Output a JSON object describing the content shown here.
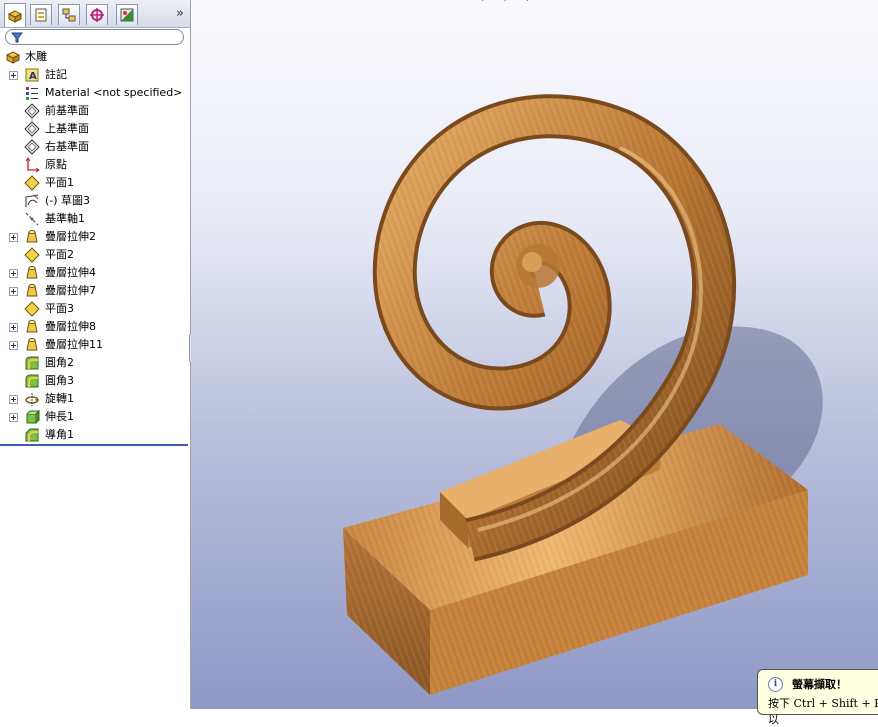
{
  "tabs": [
    {
      "name": "feature-manager-tab",
      "icon": "feature-tree-icon"
    },
    {
      "name": "property-manager-tab",
      "icon": "property-icon"
    },
    {
      "name": "configuration-manager-tab",
      "icon": "configuration-icon"
    },
    {
      "name": "dimxpert-tab",
      "icon": "crosshair-icon"
    },
    {
      "name": "display-manager-tab",
      "icon": "display-icon"
    }
  ],
  "tabbar": {
    "more": "»"
  },
  "tree": {
    "root": "木雕",
    "items": [
      {
        "label": "註記",
        "icon": "annotation-icon",
        "expandable": true
      },
      {
        "label": "Material <not specified>",
        "icon": "material-icon",
        "expandable": false
      },
      {
        "label": "前基準面",
        "icon": "plane-icon",
        "expandable": false
      },
      {
        "label": "上基準面",
        "icon": "plane-icon",
        "expandable": false
      },
      {
        "label": "右基準面",
        "icon": "plane-icon",
        "expandable": false
      },
      {
        "label": "原點",
        "icon": "origin-icon",
        "expandable": false
      },
      {
        "label": "平面1",
        "icon": "plane-feature-icon",
        "expandable": false
      },
      {
        "label": "(-) 草圖3",
        "icon": "sketch-icon",
        "expandable": false
      },
      {
        "label": "基準軸1",
        "icon": "axis-icon",
        "expandable": false
      },
      {
        "label": "疊層拉伸2",
        "icon": "loft-icon",
        "expandable": true
      },
      {
        "label": "平面2",
        "icon": "plane-feature-icon",
        "expandable": false
      },
      {
        "label": "疊層拉伸4",
        "icon": "loft-icon",
        "expandable": true
      },
      {
        "label": "疊層拉伸7",
        "icon": "loft-icon",
        "expandable": true
      },
      {
        "label": "平面3",
        "icon": "plane-feature-icon",
        "expandable": false
      },
      {
        "label": "疊層拉伸8",
        "icon": "loft-icon",
        "expandable": true
      },
      {
        "label": "疊層拉伸11",
        "icon": "loft-icon",
        "expandable": true
      },
      {
        "label": "圓角2",
        "icon": "fillet-icon",
        "expandable": false
      },
      {
        "label": "圓角3",
        "icon": "fillet-icon",
        "expandable": false
      },
      {
        "label": "旋轉1",
        "icon": "revolve-icon",
        "expandable": true
      },
      {
        "label": "伸長1",
        "icon": "extrude-icon",
        "expandable": true
      },
      {
        "label": "導角1",
        "icon": "chamfer-icon",
        "expandable": false
      }
    ]
  },
  "balloon": {
    "title": "螢幕擷取！",
    "text": "按下 Ctrl + Shift + P 以"
  },
  "colors": {
    "wood_light": "#d9a05a",
    "wood_dark": "#7a4a1e",
    "rollback_bar": "#3b5fb0"
  }
}
